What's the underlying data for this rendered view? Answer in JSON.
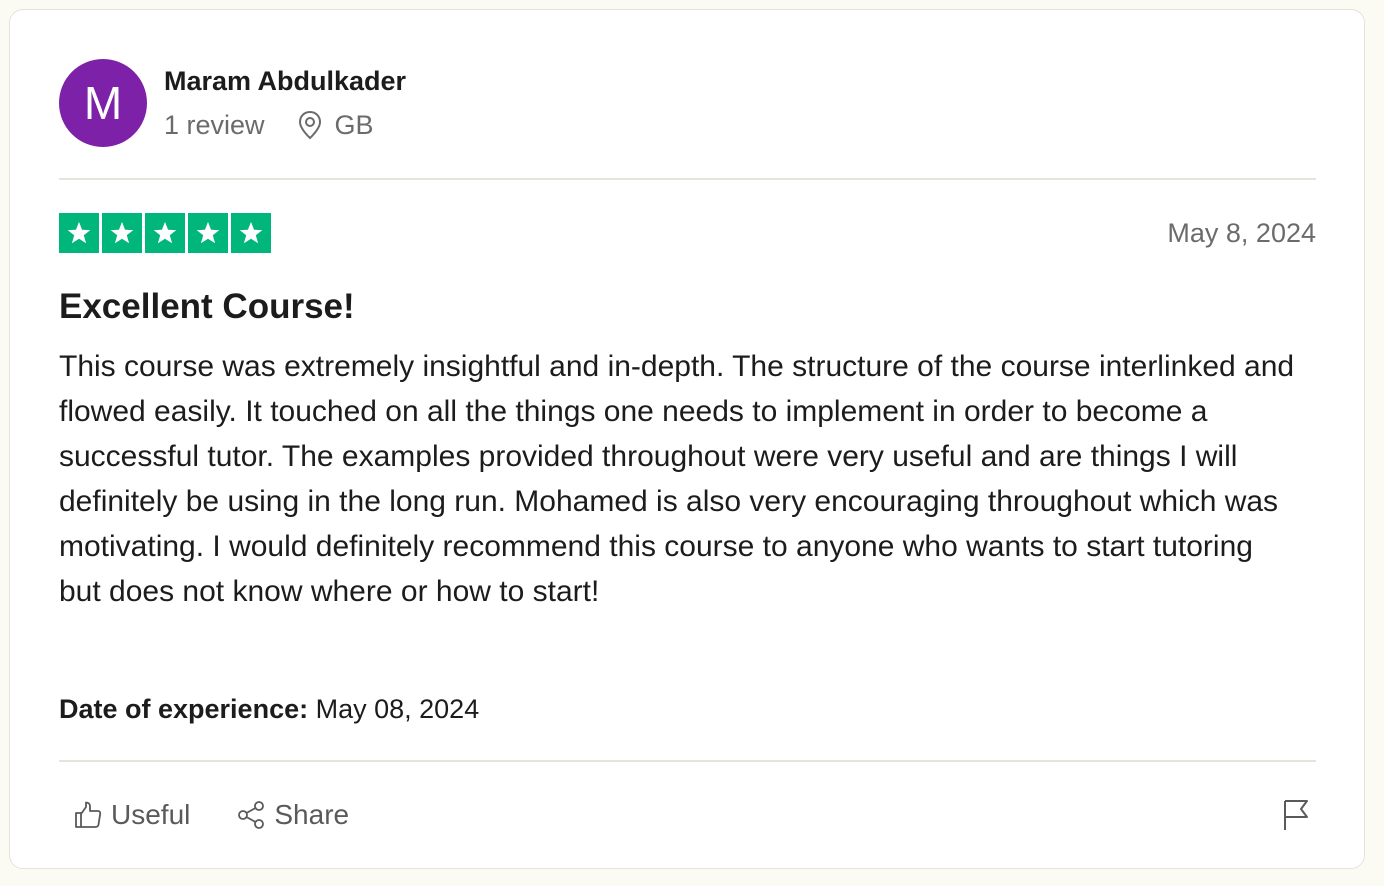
{
  "consumer": {
    "avatar_letter": "M",
    "avatar_color": "#7c21a8",
    "name": "Maram Abdulkader",
    "review_count": "1 review",
    "country": "GB"
  },
  "review": {
    "rating": 5,
    "max_rating": 5,
    "star_color": "#00b67a",
    "date": "May 8, 2024",
    "title": "Excellent Course!",
    "body": "This course was extremely insightful and in-depth. The structure of the course interlinked and flowed easily. It touched on all the things one needs to implement in order to become a successful tutor. The examples provided throughout were very useful and are things I will definitely be using in the long run. Mohamed is also very encouraging throughout which was motivating. I would definitely recommend this course to anyone who wants to start tutoring but does not know where or how to start!",
    "experience_label": "Date of experience:",
    "experience_date": "May 08, 2024"
  },
  "actions": {
    "useful_label": "Useful",
    "share_label": "Share",
    "useful_icon": "thumbs-up-icon",
    "share_icon": "share-icon",
    "report_icon": "flag-icon"
  }
}
